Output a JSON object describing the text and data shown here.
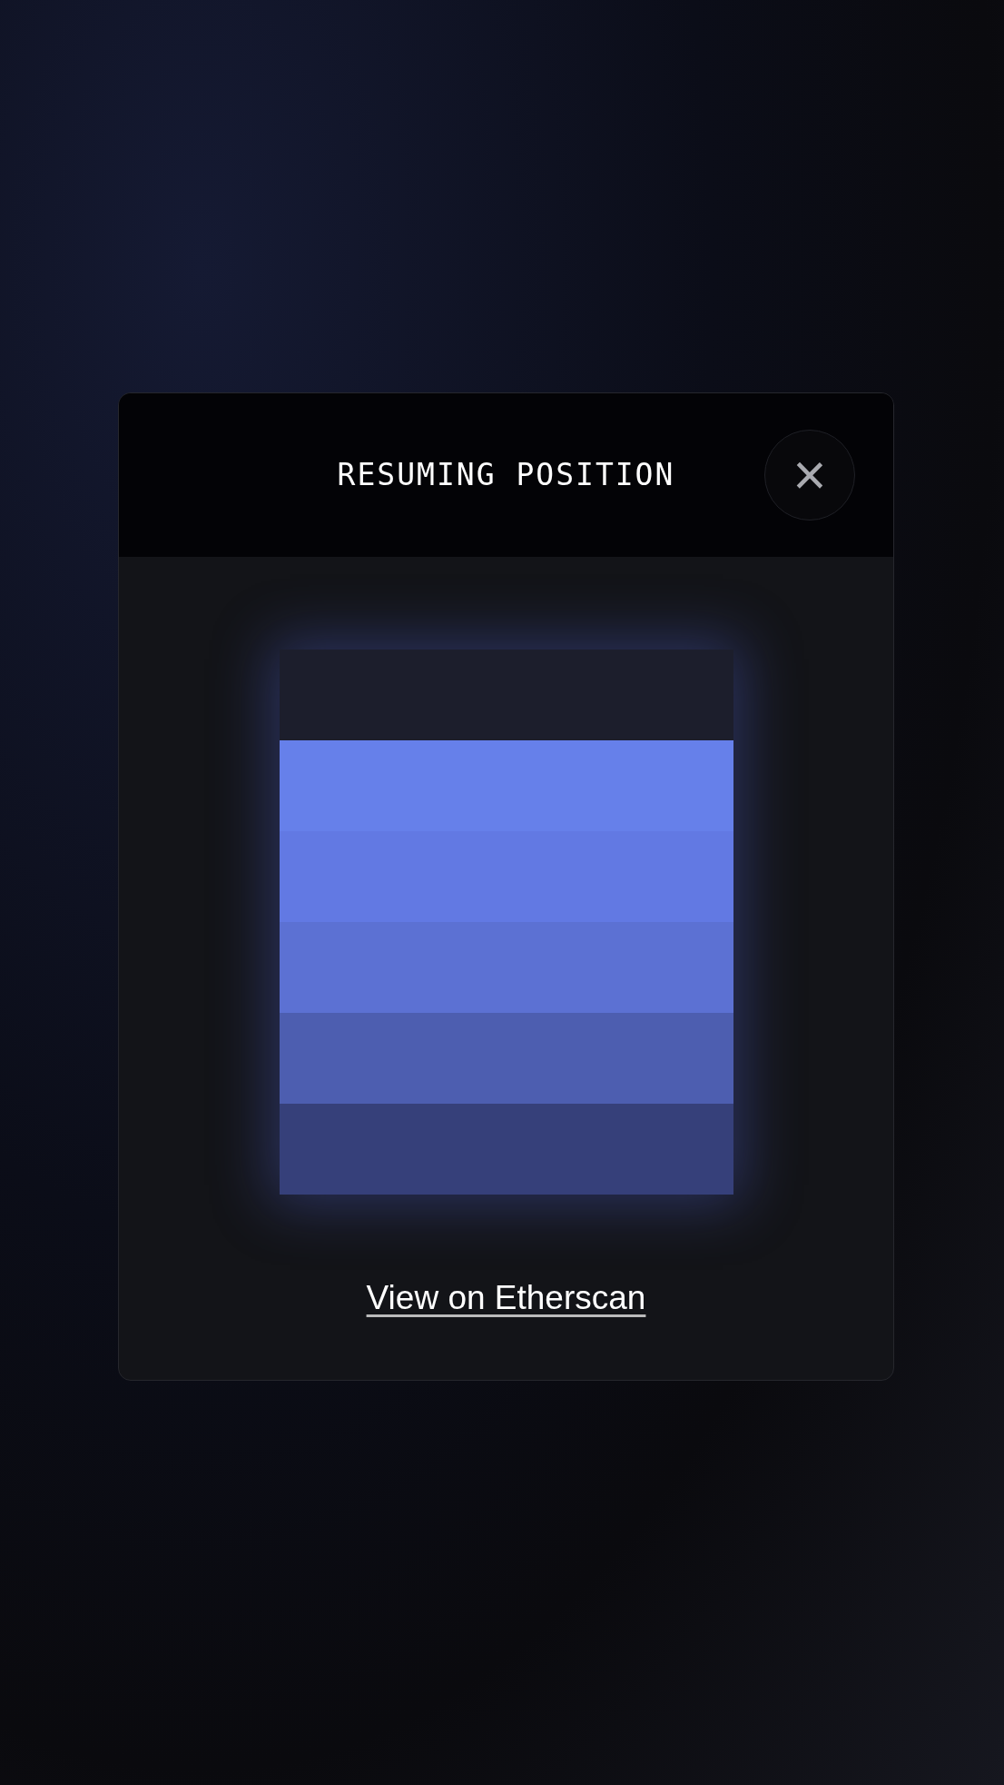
{
  "dialog": {
    "title": "RESUMING POSITION",
    "close_label": "×",
    "link": "View on Etherscan"
  }
}
